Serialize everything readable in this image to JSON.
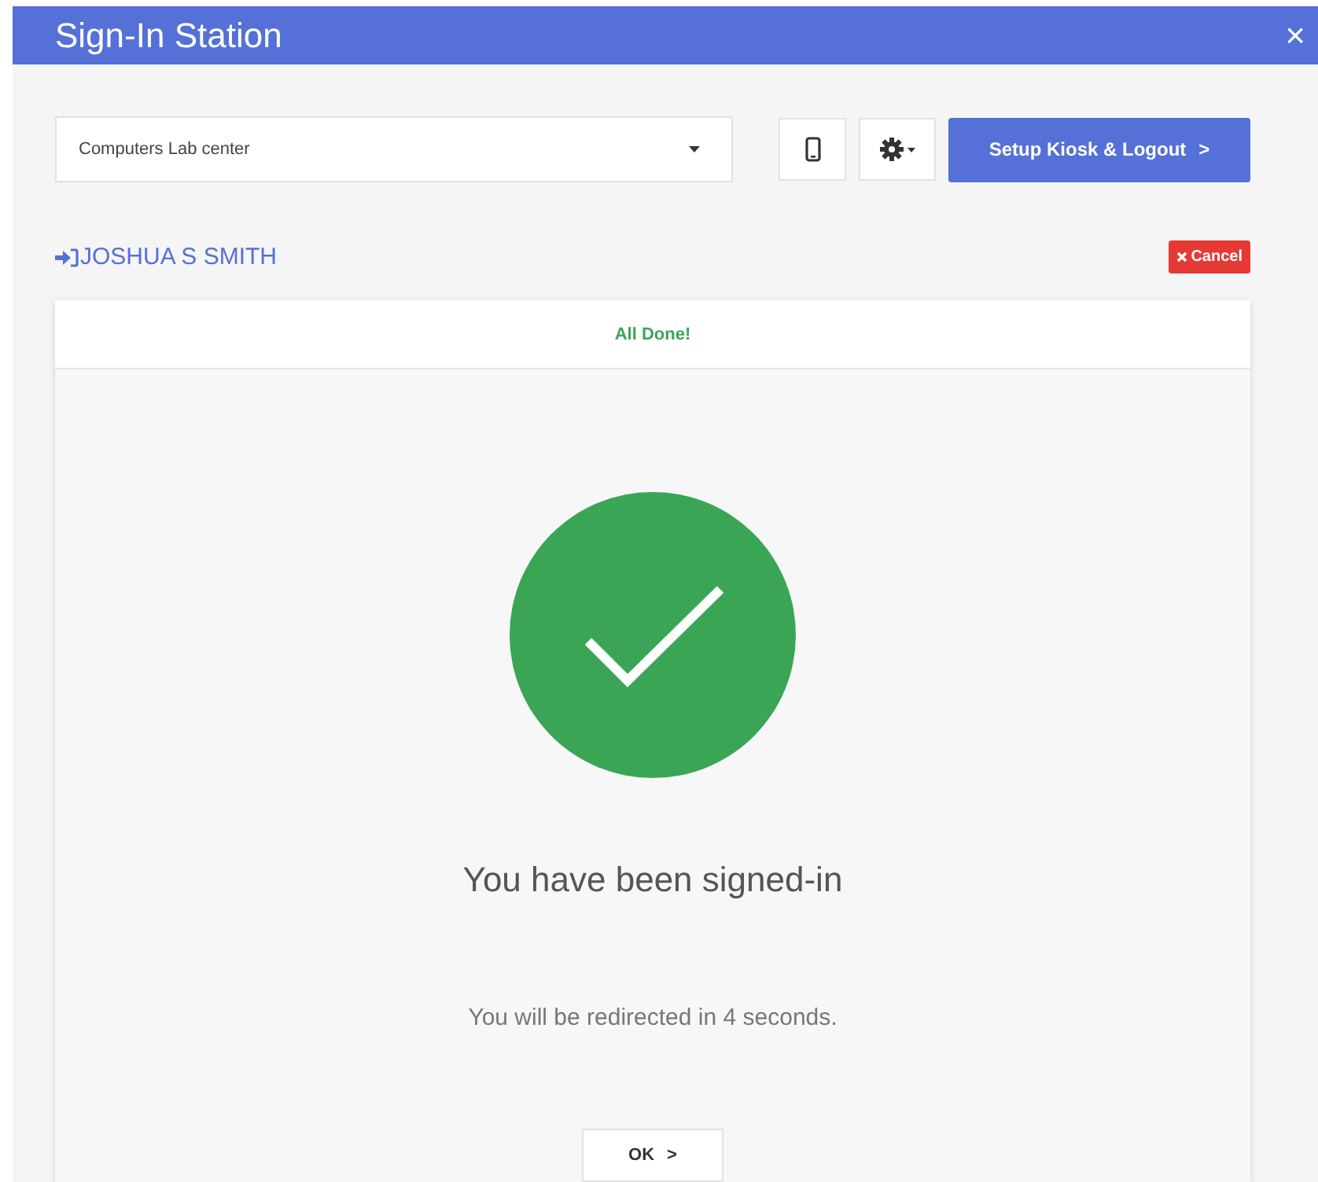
{
  "window": {
    "title": "Sign-In Station",
    "close": "×"
  },
  "toolbar": {
    "location": "Computers Lab center",
    "setup_button": {
      "label": "Setup Kiosk & Logout",
      "chevron": ">"
    }
  },
  "user": {
    "name": "JOSHUA S SMITH",
    "cancel_label": "Cancel"
  },
  "card": {
    "header": "All Done!",
    "message": "You have been signed-in",
    "redirect": "You will be redirected in 4 seconds.",
    "ok_button": {
      "label": "OK",
      "chevron": ">"
    }
  }
}
